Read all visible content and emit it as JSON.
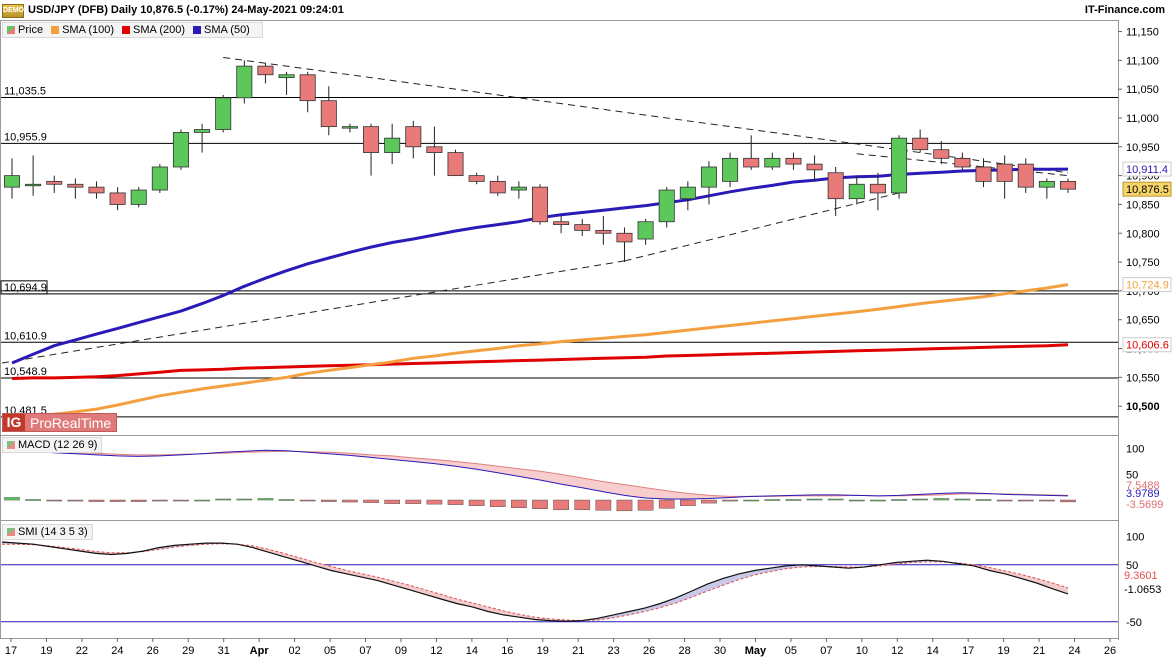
{
  "header": {
    "title": "USD/JPY (DFB) Daily 10,876.5 (-0.17%) 24-May-2021 09:24:01",
    "source": "IT-Finance.com",
    "badge": "DEMO"
  },
  "legend": [
    {
      "label": "Price",
      "color": "#6aa86a"
    },
    {
      "label": "SMA (100)",
      "color": "#f4a040"
    },
    {
      "label": "SMA (200)",
      "color": "#e00000"
    },
    {
      "label": "SMA (50)",
      "color": "#2a1ab8"
    }
  ],
  "watermark": {
    "logo": "IG",
    "name": "ProRealTime"
  },
  "colors": {
    "up": "#5cc85c",
    "down": "#e87a7a",
    "sma50": "#2a1ab8",
    "sma100": "#f4a040",
    "sma200": "#e00000",
    "macd_fill": "#f7c8c8",
    "smi_fill_up": "#c8c8e8",
    "smi_fill_down": "#f2cccc"
  },
  "chart_data": [
    {
      "type": "candlestick",
      "title": "USD/JPY (DFB) Daily",
      "x_tick_labels": [
        "17",
        "19",
        "22",
        "24",
        "26",
        "29",
        "31",
        "Apr",
        "02",
        "05",
        "07",
        "09",
        "12",
        "14",
        "16",
        "19",
        "21",
        "23",
        "26",
        "28",
        "30",
        "May",
        "05",
        "07",
        "10",
        "12",
        "14",
        "17",
        "19",
        "21",
        "24",
        "26"
      ],
      "ylim": [
        10450,
        11170
      ],
      "y_ticks": [
        10500,
        10550,
        10600,
        10650,
        10700,
        10750,
        10800,
        10850,
        10900,
        10950,
        11000,
        11050,
        11100,
        11150
      ],
      "y_tick_labels": [
        "10,500",
        "10,550",
        "10,600",
        "10,650",
        "10,700",
        "10,750",
        "10,800",
        "10,850",
        "10,900",
        "10,950",
        "11,000",
        "11,050",
        "11,100",
        "11,150"
      ],
      "horizontal_levels": [
        {
          "value": 11035.5,
          "label": "11,035.5"
        },
        {
          "value": 10955.9,
          "label": "10,955.9"
        },
        {
          "value": 10694.9,
          "label": "10,694.9"
        },
        {
          "value": 10610.9,
          "label": "10,610.9"
        },
        {
          "value": 10548.9,
          "label": "10,548.9"
        },
        {
          "value": 10481.5,
          "label": "10,481.5"
        }
      ],
      "last_values": [
        {
          "label": "10,911.4",
          "series": "SMA (50)"
        },
        {
          "label": "10,876.5",
          "series": "Price"
        },
        {
          "label": "10,724.9",
          "series": "SMA (100)"
        },
        {
          "label": "10,606.6",
          "series": "SMA (200)"
        }
      ],
      "candles": [
        {
          "o": 10880,
          "h": 10930,
          "l": 10860,
          "c": 10900
        },
        {
          "o": 10885,
          "h": 10935,
          "l": 10865,
          "c": 10885
        },
        {
          "o": 10890,
          "h": 10900,
          "l": 10870,
          "c": 10885
        },
        {
          "o": 10885,
          "h": 10895,
          "l": 10860,
          "c": 10880
        },
        {
          "o": 10880,
          "h": 10890,
          "l": 10860,
          "c": 10870
        },
        {
          "o": 10870,
          "h": 10880,
          "l": 10840,
          "c": 10850
        },
        {
          "o": 10850,
          "h": 10880,
          "l": 10845,
          "c": 10875
        },
        {
          "o": 10875,
          "h": 10920,
          "l": 10870,
          "c": 10915
        },
        {
          "o": 10915,
          "h": 10980,
          "l": 10910,
          "c": 10975
        },
        {
          "o": 10975,
          "h": 10990,
          "l": 10940,
          "c": 10980
        },
        {
          "o": 10980,
          "h": 11040,
          "l": 10975,
          "c": 11035
        },
        {
          "o": 11035,
          "h": 11100,
          "l": 11025,
          "c": 11090
        },
        {
          "o": 11090,
          "h": 11095,
          "l": 11060,
          "c": 11075
        },
        {
          "o": 11070,
          "h": 11080,
          "l": 11040,
          "c": 11075
        },
        {
          "o": 11075,
          "h": 11080,
          "l": 11010,
          "c": 11030
        },
        {
          "o": 11030,
          "h": 11055,
          "l": 10970,
          "c": 10985
        },
        {
          "o": 10985,
          "h": 10990,
          "l": 10975,
          "c": 10985
        },
        {
          "o": 10985,
          "h": 10990,
          "l": 10900,
          "c": 10940
        },
        {
          "o": 10940,
          "h": 10990,
          "l": 10920,
          "c": 10965
        },
        {
          "o": 10985,
          "h": 10995,
          "l": 10930,
          "c": 10950
        },
        {
          "o": 10950,
          "h": 10985,
          "l": 10900,
          "c": 10940
        },
        {
          "o": 10940,
          "h": 10945,
          "l": 10900,
          "c": 10900
        },
        {
          "o": 10900,
          "h": 10905,
          "l": 10885,
          "c": 10890
        },
        {
          "o": 10890,
          "h": 10900,
          "l": 10865,
          "c": 10870
        },
        {
          "o": 10875,
          "h": 10890,
          "l": 10860,
          "c": 10880
        },
        {
          "o": 10880,
          "h": 10885,
          "l": 10815,
          "c": 10820
        },
        {
          "o": 10820,
          "h": 10830,
          "l": 10800,
          "c": 10815
        },
        {
          "o": 10815,
          "h": 10825,
          "l": 10795,
          "c": 10805
        },
        {
          "o": 10805,
          "h": 10830,
          "l": 10780,
          "c": 10800
        },
        {
          "o": 10800,
          "h": 10810,
          "l": 10750,
          "c": 10785
        },
        {
          "o": 10790,
          "h": 10825,
          "l": 10780,
          "c": 10820
        },
        {
          "o": 10820,
          "h": 10880,
          "l": 10810,
          "c": 10875
        },
        {
          "o": 10860,
          "h": 10890,
          "l": 10840,
          "c": 10880
        },
        {
          "o": 10880,
          "h": 10925,
          "l": 10850,
          "c": 10915
        },
        {
          "o": 10890,
          "h": 10940,
          "l": 10880,
          "c": 10930
        },
        {
          "o": 10930,
          "h": 10970,
          "l": 10910,
          "c": 10915
        },
        {
          "o": 10915,
          "h": 10940,
          "l": 10910,
          "c": 10930
        },
        {
          "o": 10930,
          "h": 10940,
          "l": 10910,
          "c": 10920
        },
        {
          "o": 10920,
          "h": 10935,
          "l": 10890,
          "c": 10910
        },
        {
          "o": 10905,
          "h": 10915,
          "l": 10830,
          "c": 10860
        },
        {
          "o": 10860,
          "h": 10900,
          "l": 10850,
          "c": 10885
        },
        {
          "o": 10885,
          "h": 10905,
          "l": 10840,
          "c": 10870
        },
        {
          "o": 10870,
          "h": 10970,
          "l": 10860,
          "c": 10965
        },
        {
          "o": 10965,
          "h": 10980,
          "l": 10940,
          "c": 10945
        },
        {
          "o": 10945,
          "h": 10960,
          "l": 10920,
          "c": 10930
        },
        {
          "o": 10930,
          "h": 10940,
          "l": 10910,
          "c": 10915
        },
        {
          "o": 10915,
          "h": 10930,
          "l": 10880,
          "c": 10890
        },
        {
          "o": 10920,
          "h": 10935,
          "l": 10860,
          "c": 10890
        },
        {
          "o": 10920,
          "h": 10930,
          "l": 10870,
          "c": 10880
        },
        {
          "o": 10880,
          "h": 10895,
          "l": 10860,
          "c": 10890
        },
        {
          "o": 10890,
          "h": 10895,
          "l": 10870,
          "c": 10876.5
        }
      ],
      "sma50": [
        10575,
        10590,
        10605,
        10615,
        10625,
        10635,
        10645,
        10655,
        10665,
        10678,
        10692,
        10708,
        10722,
        10735,
        10747,
        10757,
        10767,
        10776,
        10784,
        10790,
        10797,
        10804,
        10810,
        10815,
        10820,
        10827,
        10832,
        10836,
        10840,
        10844,
        10848,
        10853,
        10858,
        10865,
        10872,
        10878,
        10883,
        10889,
        10892,
        10896,
        10898,
        10899,
        10902,
        10904,
        10906,
        10908,
        10909,
        10910,
        10911,
        10911,
        10911.4
      ],
      "sma100": [
        10478,
        10482,
        10486,
        10490,
        10495,
        10502,
        10510,
        10518,
        10524,
        10530,
        10535,
        10540,
        10545,
        10550,
        10557,
        10562,
        10567,
        10572,
        10577,
        10583,
        10587,
        10592,
        10596,
        10600,
        10605,
        10608,
        10612,
        10615,
        10618,
        10621,
        10624,
        10628,
        10632,
        10636,
        10640,
        10644,
        10648,
        10652,
        10656,
        10660,
        10664,
        10668,
        10673,
        10678,
        10682,
        10686,
        10690,
        10695,
        10700,
        10705,
        10711
      ],
      "sma200": [
        10548,
        10549,
        10549,
        10550,
        10551,
        10553,
        10556,
        10559,
        10562,
        10563,
        10564,
        10566,
        10567,
        10568,
        10569,
        10570,
        10571,
        10572,
        10573,
        10574,
        10575,
        10576,
        10577,
        10578,
        10579,
        10580,
        10581,
        10582,
        10583,
        10584,
        10585,
        10587,
        10588,
        10589,
        10590,
        10591,
        10592,
        10593,
        10594,
        10595,
        10596,
        10597,
        10598,
        10599,
        10600,
        10601,
        10602,
        10603,
        10604,
        10605,
        10606.6
      ]
    },
    {
      "type": "bar",
      "title": "MACD (12 26 9)",
      "ylim": [
        -35,
        115
      ],
      "y_ticks": [
        0,
        50,
        100
      ],
      "y_tick_labels": [
        "",
        "50",
        "100"
      ],
      "last_values": [
        "7.5488",
        "3.9789",
        "-3.5699"
      ],
      "macd": [
        100,
        95,
        92,
        90,
        88,
        86,
        85,
        86,
        88,
        90,
        93,
        95,
        97,
        96,
        93,
        90,
        87,
        83,
        79,
        75,
        71,
        66,
        60,
        53,
        46,
        39,
        31,
        24,
        16,
        9,
        4,
        2,
        2,
        3,
        5,
        7,
        8,
        9,
        10,
        10,
        9,
        8,
        9,
        11,
        13,
        14,
        13,
        11,
        10,
        9,
        8
      ],
      "signal": [
        95,
        94,
        93,
        92,
        91,
        89,
        88,
        88,
        89,
        90,
        91,
        93,
        94,
        95,
        94,
        93,
        91,
        88,
        86,
        82,
        79,
        75,
        71,
        66,
        61,
        56,
        50,
        43,
        36,
        30,
        24,
        18,
        13,
        9,
        7,
        7,
        7,
        8,
        8,
        8,
        9,
        8,
        8,
        9,
        10,
        12,
        12,
        12,
        11,
        10,
        9
      ],
      "histogram": [
        5,
        1,
        -1,
        -2,
        -3,
        -3,
        -3,
        -2,
        -1,
        0,
        2,
        2,
        3,
        1,
        -1,
        -3,
        -4,
        -5,
        -7,
        -7,
        -8,
        -9,
        -11,
        -13,
        -15,
        -17,
        -19,
        -19,
        -20,
        -21,
        -20,
        -16,
        -11,
        -6,
        -2,
        0,
        1,
        1,
        2,
        2,
        0,
        0,
        1,
        2,
        3,
        2,
        1,
        -1,
        -1,
        -1,
        -3.5699
      ]
    },
    {
      "type": "line",
      "title": "SMI (14 3 5 3)",
      "ylim": [
        -75,
        125
      ],
      "y_ticks": [
        -50,
        50,
        100
      ],
      "y_tick_labels": [
        "-50",
        "50",
        "100"
      ],
      "last_values": [
        "9.3601",
        "-1.0653"
      ],
      "smi": [
        90,
        88,
        86,
        82,
        78,
        74,
        70,
        68,
        70,
        74,
        80,
        84,
        86,
        88,
        88,
        86,
        80,
        72,
        64,
        56,
        48,
        40,
        34,
        28,
        22,
        14,
        6,
        -2,
        -10,
        -18,
        -24,
        -32,
        -38,
        -42,
        -46,
        -48,
        -49,
        -48,
        -44,
        -38,
        -32,
        -26,
        -18,
        -8,
        4,
        16,
        26,
        34,
        40,
        44,
        48,
        50,
        48,
        46,
        44,
        46,
        50,
        54,
        56,
        58,
        56,
        52,
        48,
        40,
        34,
        26,
        18,
        8,
        -1.0653
      ],
      "signal": [
        86,
        86,
        85,
        83,
        80,
        77,
        73,
        71,
        71,
        73,
        77,
        81,
        84,
        86,
        87,
        86,
        83,
        77,
        70,
        62,
        54,
        47,
        40,
        34,
        28,
        21,
        14,
        6,
        -2,
        -10,
        -17,
        -24,
        -31,
        -37,
        -42,
        -45,
        -47,
        -48,
        -47,
        -43,
        -38,
        -32,
        -25,
        -17,
        -7,
        4,
        14,
        24,
        32,
        38,
        43,
        46,
        47,
        47,
        46,
        46,
        48,
        51,
        54,
        55,
        55,
        53,
        50,
        45,
        39,
        33,
        26,
        18,
        9.3601
      ]
    }
  ]
}
